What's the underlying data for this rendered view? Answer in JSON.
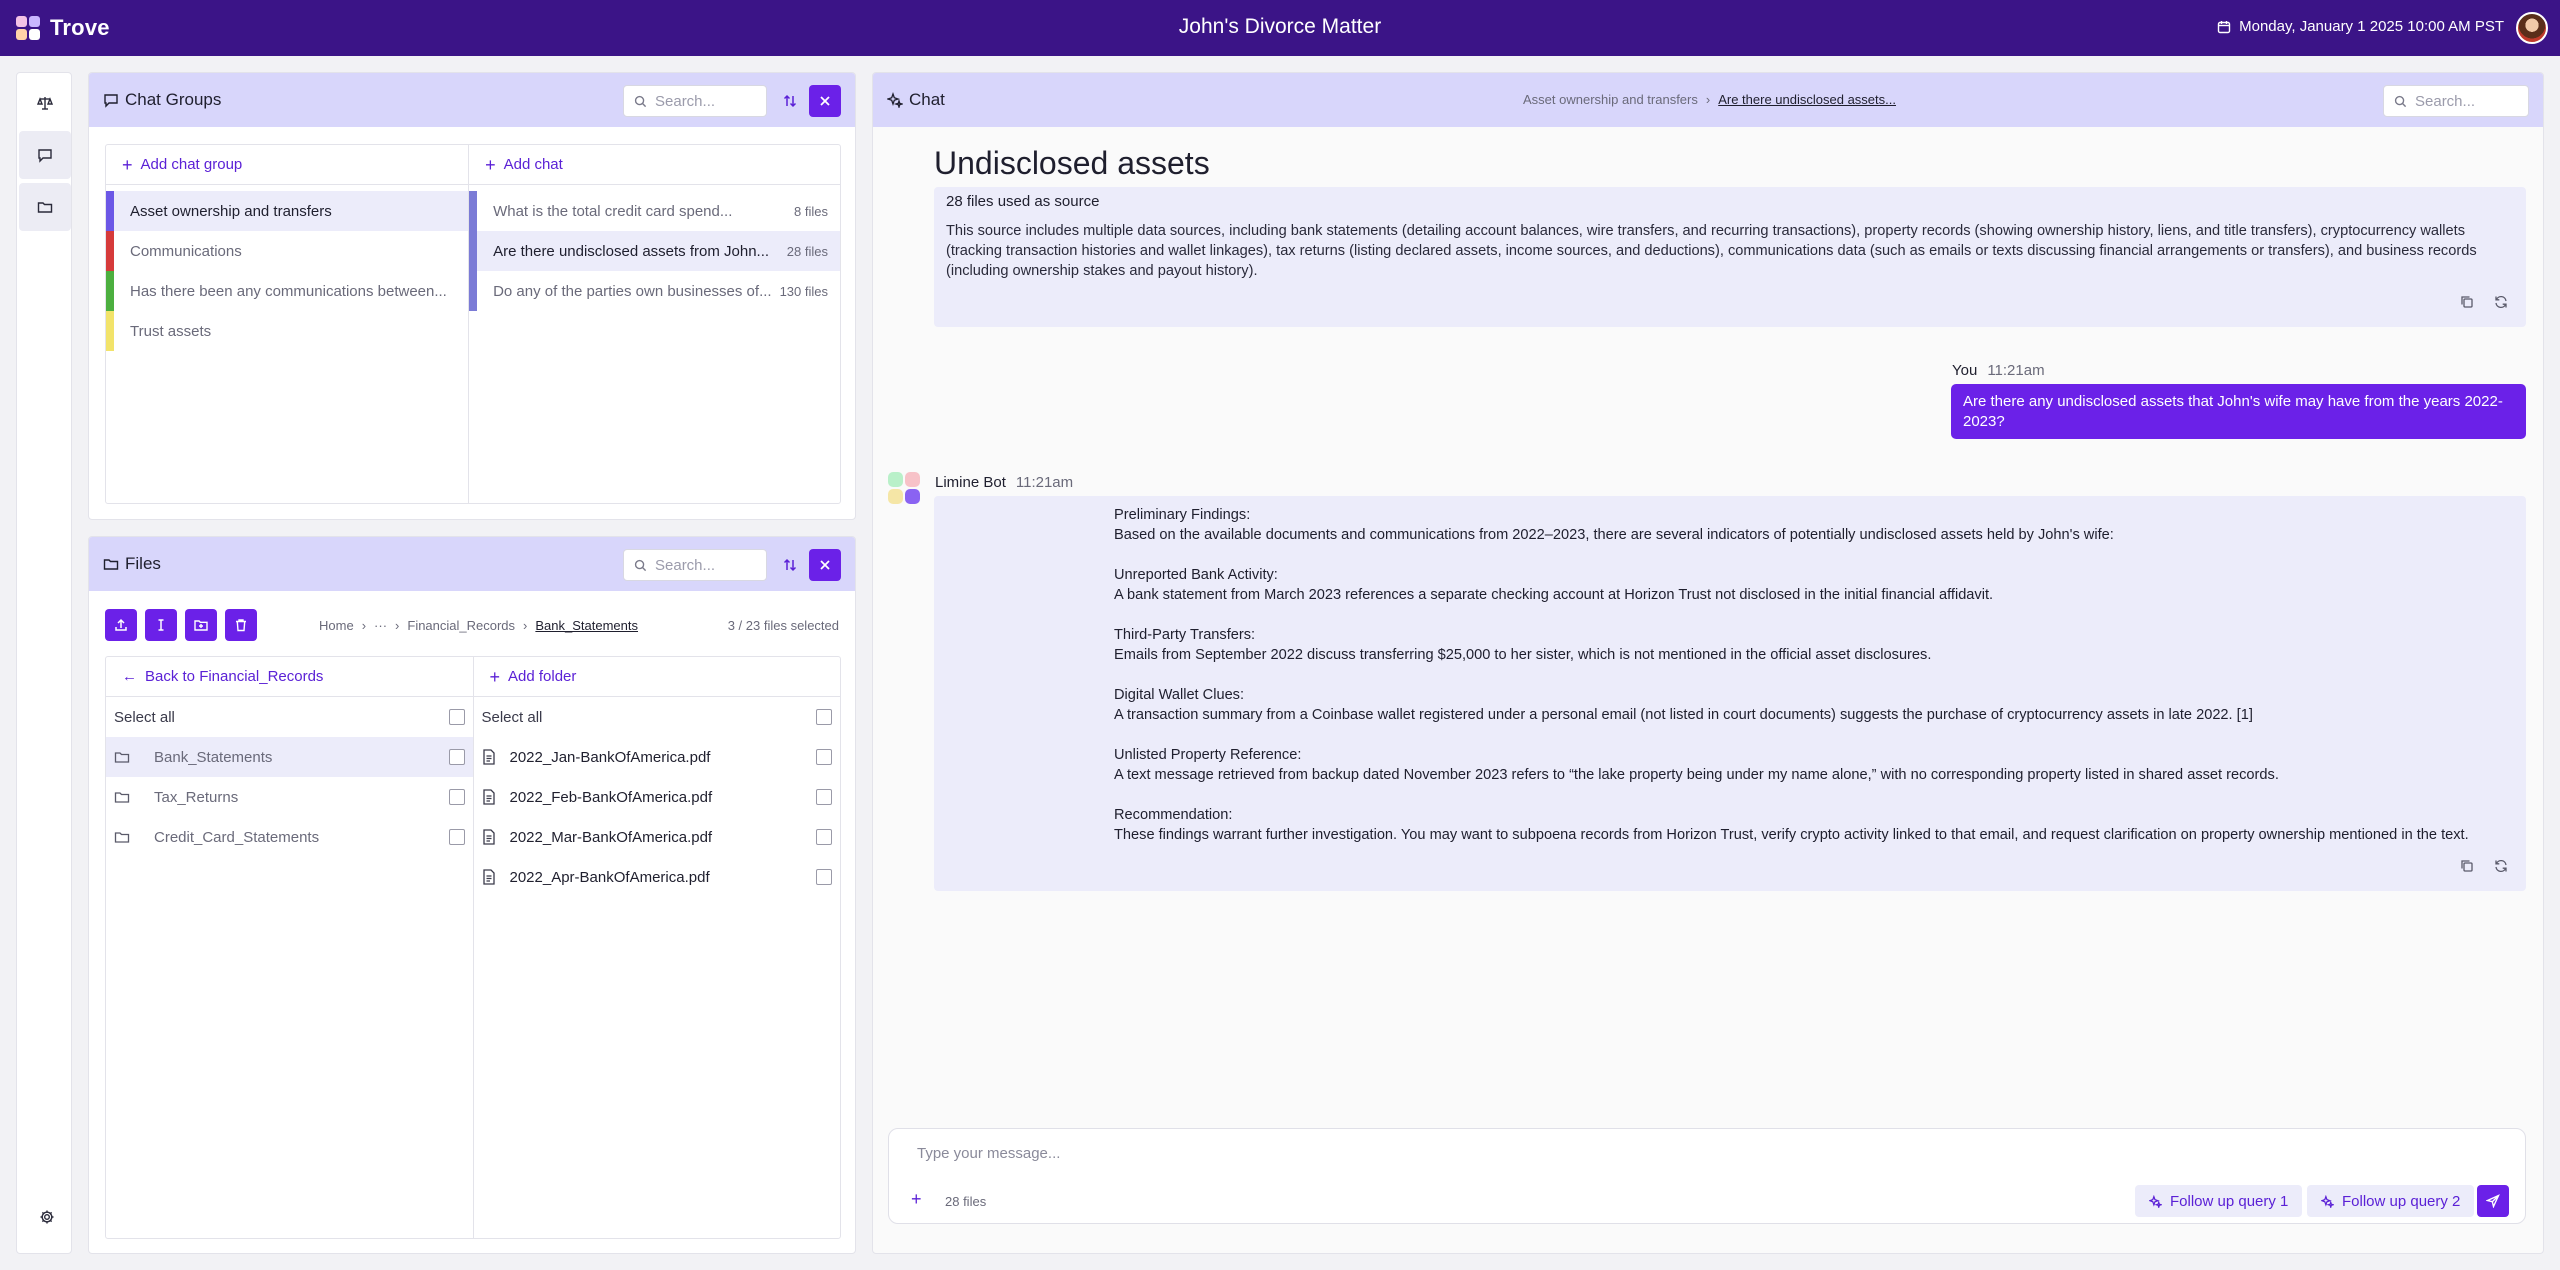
{
  "app": {
    "name": "Trove",
    "matter_title": "John's Divorce Matter",
    "datetime": "Monday, January 1 2025 10:00 AM PST"
  },
  "rail": {
    "items": [
      "scales-icon",
      "chat-icon",
      "folder-icon"
    ],
    "bottom": "gear-icon"
  },
  "chat_groups": {
    "title": "Chat Groups",
    "search_placeholder": "Search...",
    "add_group_label": "Add chat group",
    "add_chat_label": "Add chat",
    "groups": [
      {
        "label": "Asset ownership and transfers",
        "color": "#6b57e6",
        "active": true
      },
      {
        "label": "Communications",
        "color": "#d63a3a",
        "active": false
      },
      {
        "label": "Has there been any communications between...",
        "color": "#4caf3f",
        "active": false
      },
      {
        "label": "Trust assets",
        "color": "#f2e36a",
        "active": false
      }
    ],
    "chats": [
      {
        "label": "What is the total credit card spend...",
        "count": "8 files",
        "active": false
      },
      {
        "label": "Are there undisclosed assets from John...",
        "count": "28 files",
        "active": true
      },
      {
        "label": "Do any of the parties own businesses of...",
        "count": "130 files",
        "active": false
      }
    ]
  },
  "files": {
    "title": "Files",
    "search_placeholder": "Search...",
    "breadcrumb": [
      "Home",
      "···",
      "Financial_Records",
      "Bank_Statements"
    ],
    "selection_count": "3 / 23 files selected",
    "back_label": "Back to Financial_Records",
    "add_folder_label": "Add folder",
    "select_all_label": "Select all",
    "folders": [
      "Bank_Statements",
      "Tax_Returns",
      "Credit_Card_Statements"
    ],
    "pdfs": [
      "2022_Jan-BankOfAmerica.pdf",
      "2022_Feb-BankOfAmerica.pdf",
      "2022_Mar-BankOfAmerica.pdf",
      "2022_Apr-BankOfAmerica.pdf"
    ]
  },
  "chat": {
    "title": "Chat",
    "breadcrumb": [
      "Asset ownership and transfers",
      "Are there undisclosed assets..."
    ],
    "search_placeholder": "Search...",
    "heading": "Undisclosed assets",
    "source_title": "28 files used as source",
    "source_desc": "This source includes multiple data sources, including bank statements (detailing account balances, wire transfers, and recurring transactions), property records (showing ownership history, liens, and title transfers), cryptocurrency wallets (tracking transaction histories and wallet linkages), tax returns (listing declared assets, income sources, and deductions), communications data (such as emails or texts discussing financial arrangements or transfers), and business records (including ownership stakes and payout history).",
    "user_name": "You",
    "user_time": "11:21am",
    "user_message": "Are there any undisclosed assets that John's wife may have from the years 2022-2023?",
    "bot_name": "Limine Bot",
    "bot_time": "11:21am",
    "bot_paragraphs": [
      {
        "heading": "Preliminary Findings:",
        "text": "Based on the available documents and communications from 2022–2023, there are several indicators of potentially undisclosed assets held by John's wife:"
      },
      {
        "heading": "Unreported Bank Activity:",
        "text": "A bank statement from March 2023 references a separate checking account at Horizon Trust not disclosed in the initial financial affidavit."
      },
      {
        "heading": "Third-Party Transfers:",
        "text": "Emails from September 2022 discuss transferring $25,000 to her sister, which is not mentioned in the official asset disclosures."
      },
      {
        "heading": "Digital Wallet Clues:",
        "text": "A transaction summary from a Coinbase wallet registered under a personal email (not listed in court documents) suggests the purchase of cryptocurrency assets in late 2022. [1]"
      },
      {
        "heading": "Unlisted Property Reference:",
        "text": "A text message retrieved from backup dated November 2023 refers to “the lake property being under my name alone,” with no corresponding property listed in shared asset records."
      },
      {
        "heading": "Recommendation:",
        "text": "These findings warrant further investigation. You may want to subpoena records from Horizon Trust, verify crypto activity linked to that email, and request clarification on property ownership mentioned in the text."
      }
    ],
    "composer_placeholder": "Type your message...",
    "composer_files": "28 files",
    "followups": [
      "Follow up query 1",
      "Follow up query 2"
    ]
  },
  "colors": {
    "topbar": "#3b1487",
    "accent": "#6b21e8",
    "header_bg": "#d8d6fb",
    "card_bg": "#ececfa"
  }
}
